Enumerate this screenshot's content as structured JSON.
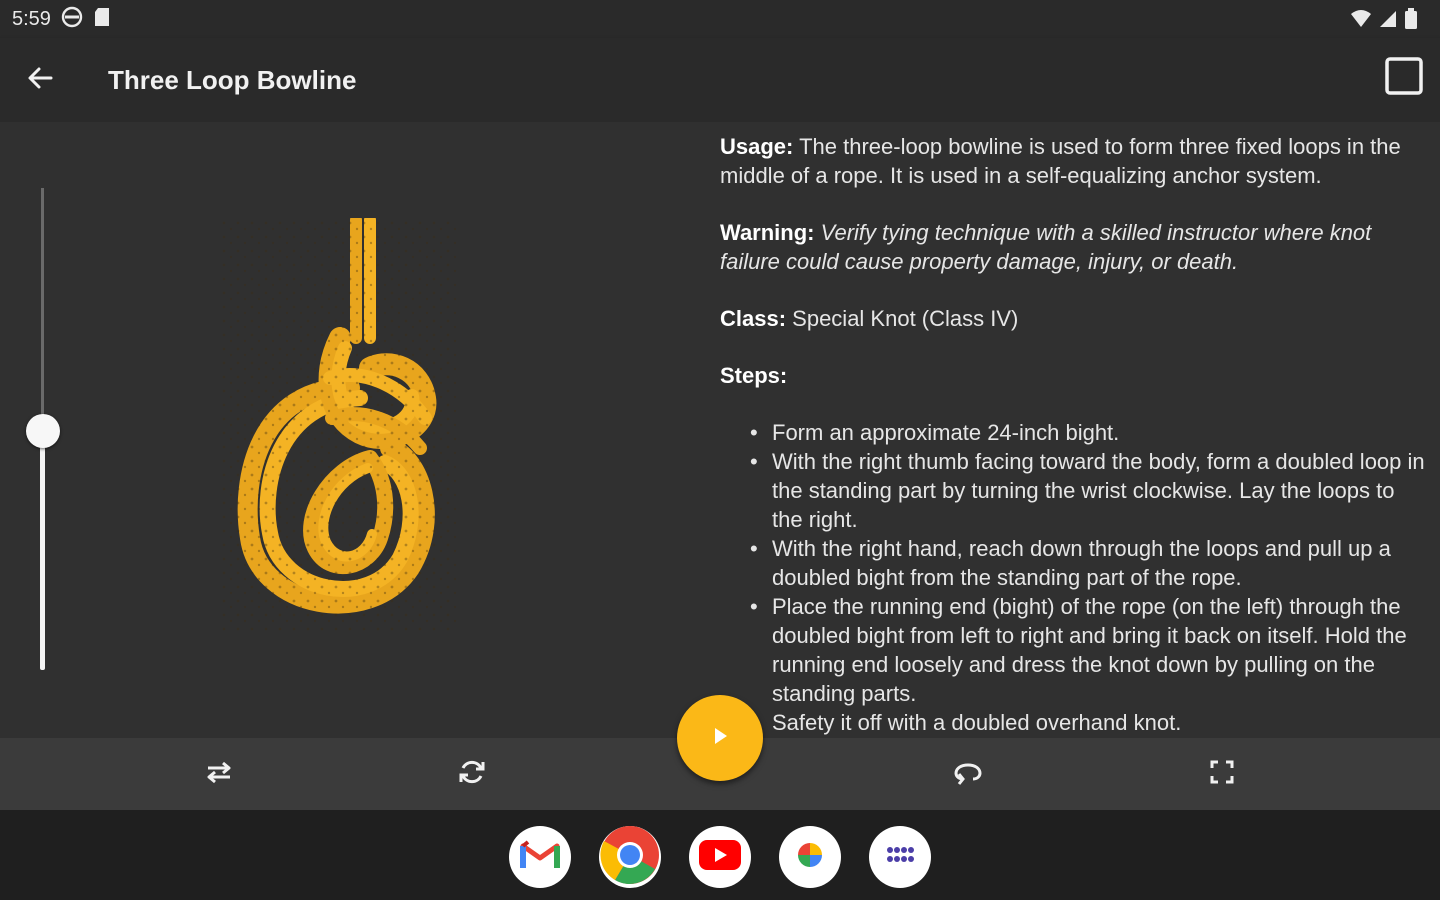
{
  "status_bar": {
    "time": "5:59"
  },
  "app_bar": {
    "title": "Three Loop Bowline"
  },
  "info": {
    "usage_label": "Usage:",
    "usage_text": " The three-loop bowline is used to form three fixed loops in the middle of a rope. It is used in a self-equalizing anchor system.",
    "warning_label": "Warning:",
    "warning_text": " Verify tying technique with a skilled instructor where knot failure could cause property damage, injury, or death.",
    "class_label": "Class:",
    "class_text": " Special Knot (Class IV)",
    "steps_label": "Steps:",
    "steps": [
      "Form an approximate 24-inch bight.",
      "With the right thumb facing toward the body, form a doubled loop in the standing part by turning the wrist clockwise. Lay the loops to the right.",
      "With the right hand, reach down through the loops and pull up a doubled bight from the standing part of the rope.",
      "Place the running end (bight) of the rope (on the left) through the doubled bight from left to right and bring it back on itself. Hold the running end loosely and dress the knot down by pulling on the standing parts.",
      "Safety it off with a doubled overhand knot."
    ]
  },
  "slider": {
    "value": 0.5
  },
  "colors": {
    "accent": "#fbb817",
    "rope": "#f4b324",
    "background": "#303030",
    "bar": "#2a2a2a"
  },
  "controls": [
    "swap-icon",
    "rotate-icon",
    "play-icon",
    "loop-icon",
    "fullscreen-icon"
  ],
  "dock": [
    "gmail-icon",
    "chrome-icon",
    "youtube-icon",
    "photos-icon",
    "app-drawer-icon"
  ]
}
